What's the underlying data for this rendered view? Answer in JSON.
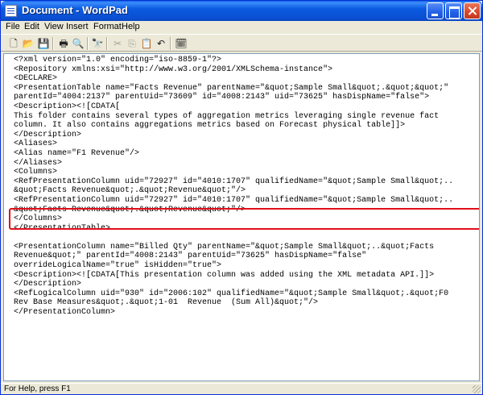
{
  "window": {
    "title": "Document - WordPad"
  },
  "menu": [
    "File",
    "Edit",
    "View",
    "Insert",
    "Format",
    "Help"
  ],
  "toolbar": {
    "buttons": [
      {
        "icon": "new-document-icon",
        "glyph": "🗋"
      },
      {
        "icon": "open-folder-icon",
        "glyph": "📂"
      },
      {
        "icon": "save-icon",
        "glyph": "💾"
      },
      {
        "icon": "print-icon",
        "glyph": "🖶"
      },
      {
        "icon": "print-preview-icon",
        "glyph": "🔍"
      },
      {
        "icon": "find-icon",
        "glyph": "🔭"
      },
      {
        "icon": "cut-icon",
        "glyph": "✂"
      },
      {
        "icon": "copy-icon",
        "glyph": "⎘"
      },
      {
        "icon": "paste-icon",
        "glyph": "📋"
      },
      {
        "icon": "undo-icon",
        "glyph": "↶"
      },
      {
        "icon": "insert-date-time-icon",
        "glyph": "🗓"
      }
    ]
  },
  "document": {
    "lines": [
      "<?xml version=\"1.0\" encoding=\"iso-8859-1\"?>",
      "<Repository xmlns:xsi=\"http://www.w3.org/2001/XMLSchema-instance\">",
      "<DECLARE>",
      "<PresentationTable name=\"Facts Revenue\" parentName=\"&quot;Sample Small&quot;.&quot;&quot;\"",
      "parentId=\"4004:2137\" parentUid=\"73609\" id=\"4008:2143\" uid=\"73625\" hasDispName=\"false\">",
      "<Description><![CDATA[",
      "This folder contains several types of aggregation metrics leveraging single revenue fact",
      "column. It also contains aggregations metrics based on Forecast physical table]]>",
      "</Description>",
      "<Aliases>",
      "<Alias name=\"F1 Revenue\"/>",
      "</Aliases>",
      "<Columns>",
      "<RefPresentationColumn uid=\"72927\" id=\"4010:1707\" qualifiedName=\"&quot;Sample Small&quot;..",
      "&quot;Facts Revenue&quot;.&quot;Revenue&quot;\"/>",
      "<RefPresentationColumn uid=\"72927\" id=\"4010:1707\" qualifiedName=\"&quot;Sample Small&quot;..",
      "&quot;Facts Revenue&quot;.&quot;Revenue&quot;\"/>",
      "</Columns>",
      "</PresentationTable>",
      "",
      "<PresentationColumn name=\"Billed Qty\" parentName=\"&quot;Sample Small&quot;..&quot;Facts",
      "Revenue&quot;\" parentId=\"4008:2143\" parentUid=\"73625\" hasDispName=\"false\"",
      "overrideLogicalName=\"true\" isHidden=\"true\">",
      "<Description><![CDATA[This presentation column was added using the XML metadata API.]]>",
      "</Description>",
      "<RefLogicalColumn uid=\"930\" id=\"2006:102\" qualifiedName=\"&quot;Sample Small&quot;.&quot;F0",
      "Rev Base Measures&quot;.&quot;1-01  Revenue  (Sum All)&quot;\"/>",
      "</PresentationColumn>"
    ]
  },
  "status": {
    "text": "For Help, press F1"
  },
  "colors": {
    "highlight": "#e0101a",
    "titlebar": "#0a4fd1"
  }
}
